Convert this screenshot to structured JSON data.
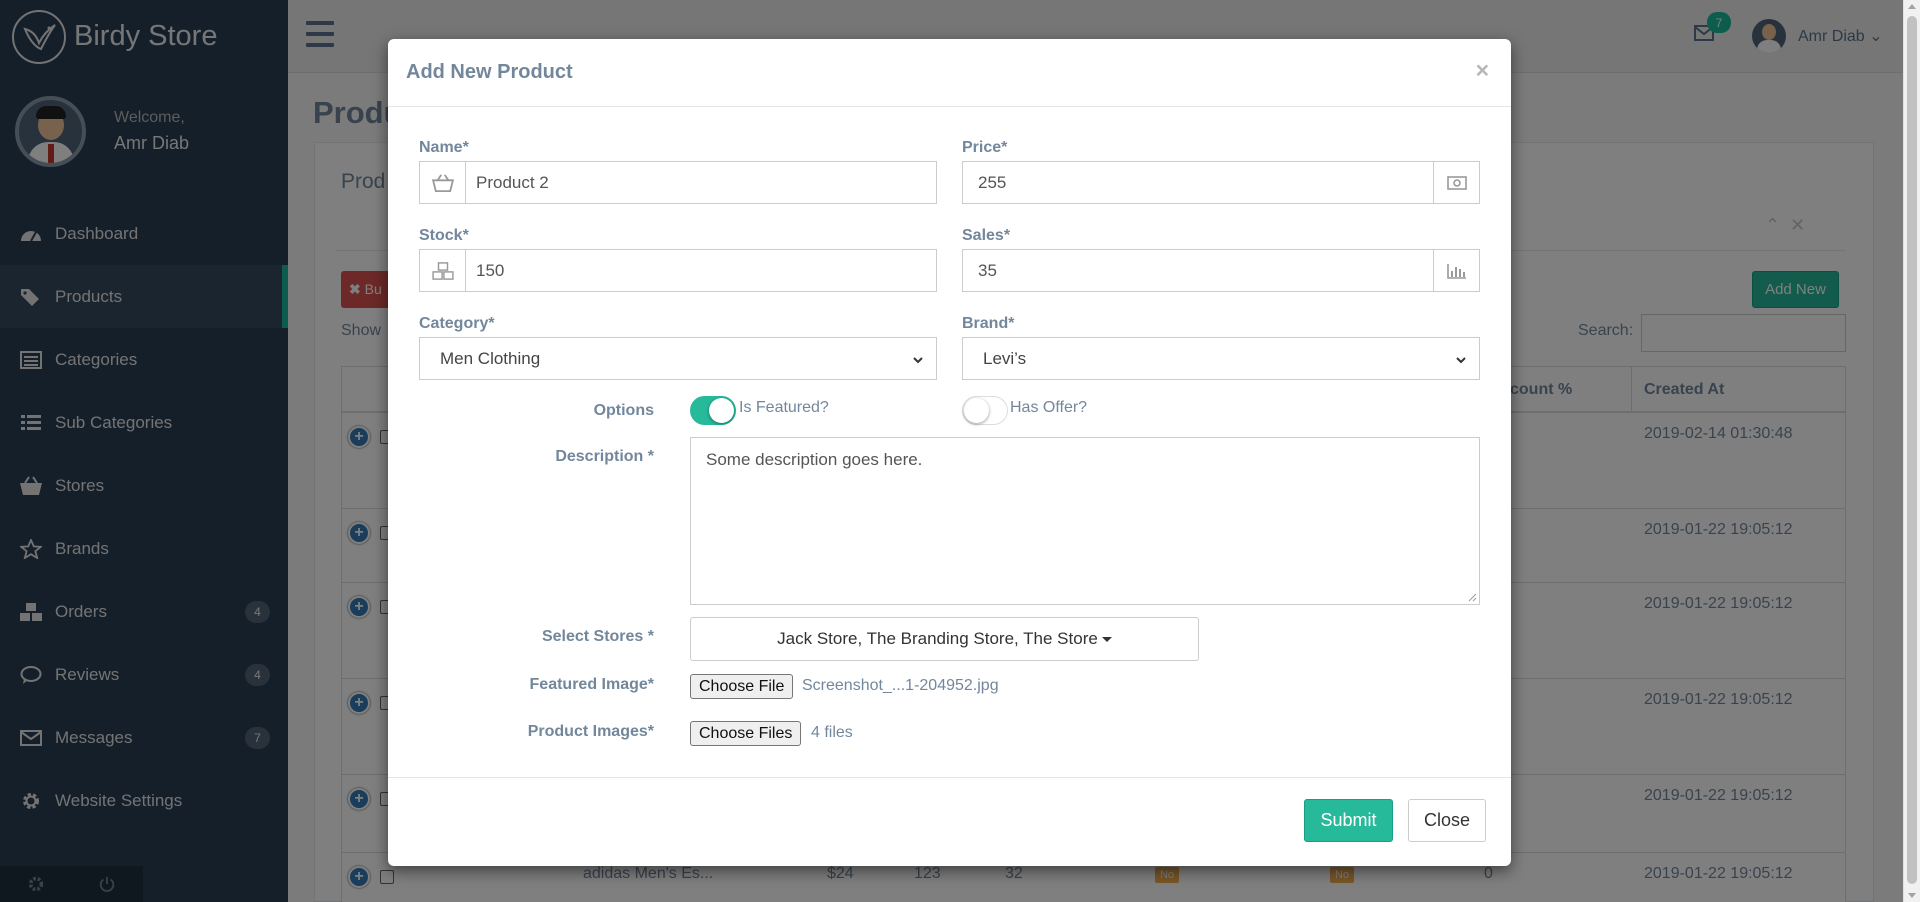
{
  "sidebar": {
    "brand": "Birdy Store",
    "welcome": "Welcome,",
    "user_name": "Amr Diab",
    "items": [
      {
        "label": "Dashboard",
        "icon": "dashboard-icon"
      },
      {
        "label": "Products",
        "icon": "tags-icon",
        "active": true
      },
      {
        "label": "Categories",
        "icon": "list-alt-icon"
      },
      {
        "label": "Sub Categories",
        "icon": "list-icon"
      },
      {
        "label": "Stores",
        "icon": "shopping-basket-icon"
      },
      {
        "label": "Brands",
        "icon": "star-icon"
      },
      {
        "label": "Orders",
        "icon": "cubes-icon",
        "badge": "4"
      },
      {
        "label": "Reviews",
        "icon": "comments-icon",
        "badge": "4"
      },
      {
        "label": "Messages",
        "icon": "envelope-icon",
        "badge": "7"
      },
      {
        "label": "Website Settings",
        "icon": "gear-icon"
      }
    ]
  },
  "topnav": {
    "mail_badge": "7",
    "user_name": "Amr Diab"
  },
  "page": {
    "title": "Produ",
    "panel_title": "Prod",
    "bulk_label": "Bu",
    "add_new": "Add New",
    "show_label": "Show",
    "search_label": "Search:",
    "columns": {
      "discount": "count %",
      "created": "Created At"
    },
    "rows": [
      {
        "date": "2019-02-14 01:30:48"
      },
      {
        "date": "2019-01-22 19:05:12"
      },
      {
        "date": "2019-01-22 19:05:12"
      },
      {
        "date": "2019-01-22 19:05:12"
      },
      {
        "date": "2019-01-22 19:05:12"
      },
      {
        "date": "2019-01-22 19:05:12",
        "name": "adidas Men's Es...",
        "price": "$24",
        "stock": "123",
        "sales": "32",
        "featured": "No",
        "offer": "No",
        "discount": "0"
      }
    ]
  },
  "modal": {
    "title": "Add New Product",
    "close_x": "×",
    "name": {
      "label": "Name*",
      "value": "Product 2"
    },
    "price": {
      "label": "Price*",
      "value": "255"
    },
    "stock": {
      "label": "Stock*",
      "value": "150"
    },
    "sales": {
      "label": "Sales*",
      "value": "35"
    },
    "category": {
      "label": "Category*",
      "value": "Men Clothing"
    },
    "brand": {
      "label": "Brand*",
      "value": "Levi’s"
    },
    "options_label": "Options",
    "is_featured": {
      "label": "Is Featured?",
      "on": true
    },
    "has_offer": {
      "label": "Has Offer?",
      "on": false
    },
    "description": {
      "label": "Description *",
      "value": "Some description goes here."
    },
    "stores": {
      "label": "Select Stores *",
      "value": "Jack Store, The Branding Store, The Store"
    },
    "featured_image": {
      "label": "Featured Image*",
      "button": "Choose File",
      "file": "Screenshot_...1-204952.jpg"
    },
    "product_images": {
      "label": "Product Images*",
      "button": "Choose Files",
      "file": "4 files"
    },
    "submit": "Submit",
    "close": "Close"
  },
  "colors": {
    "accent": "#26b99a",
    "sidebar": "#2a3f54",
    "label": "#73879c",
    "danger": "#d9534f"
  }
}
